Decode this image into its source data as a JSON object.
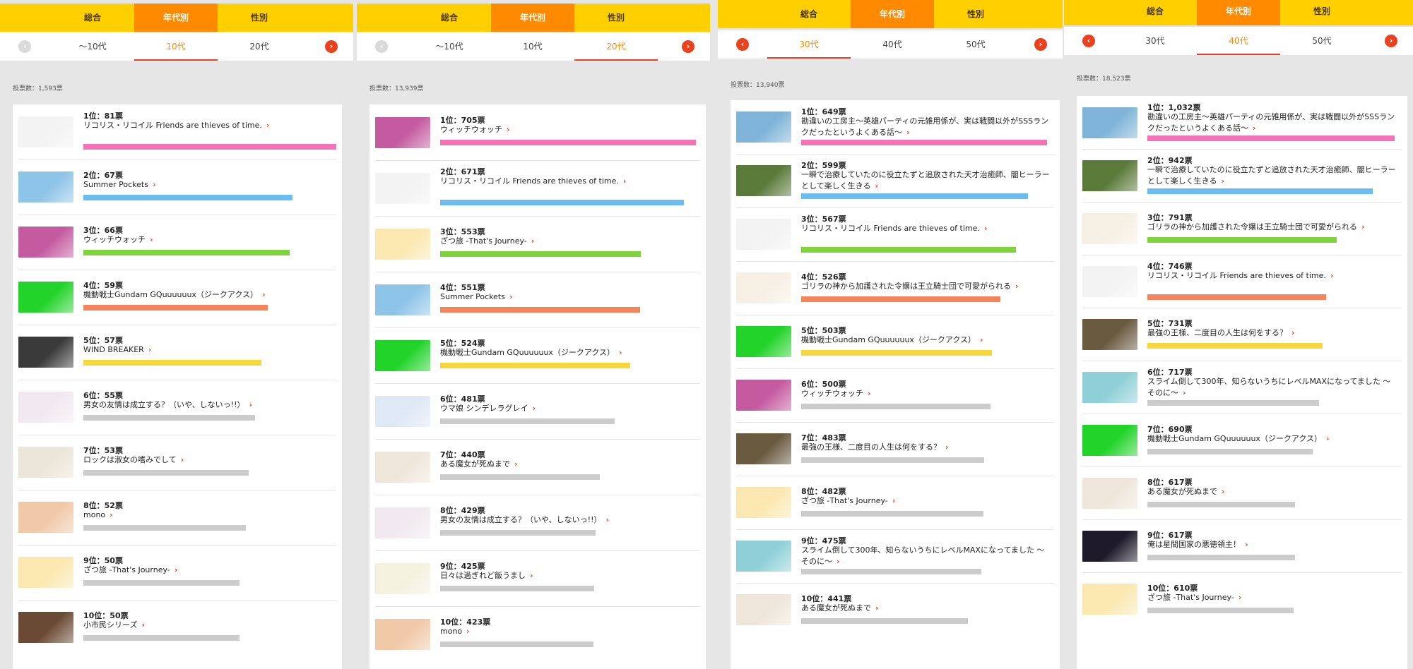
{
  "tabs": [
    "総合",
    "年代別",
    "性別"
  ],
  "arrows": {
    "prev": "‹",
    "next": "›"
  },
  "colors": {
    "yellow": "#ffcf00",
    "orange": "#ff8a00",
    "red": "#e8431e",
    "bar_pink": "#f472b6",
    "bar_blue": "#6bbcf0",
    "bar_green": "#7ed43a",
    "bar_orange": "#f5845a",
    "bar_yellow": "#f7d73a",
    "bar_gray": "#cccccc"
  },
  "panels": [
    {
      "subtabs": [
        "〜10代",
        "10代",
        "20代"
      ],
      "active_subtab": 1,
      "votes_label": "投票数：1,593票",
      "items": [
        {
          "rank": "1位：81票",
          "title": "リコリス・リコイル Friends are thieves of time.",
          "value": 81,
          "thumb": "#f3f3f3"
        },
        {
          "rank": "2位：67票",
          "title": "Summer Pockets",
          "value": 67,
          "thumb": "#8ec4e8"
        },
        {
          "rank": "3位：66票",
          "title": "ウィッチウォッチ",
          "value": 66,
          "thumb": "#c45aa0"
        },
        {
          "rank": "4位：59票",
          "title": "機動戦士Gundam GQuuuuuux（ジークアクス）",
          "value": 59,
          "thumb": "#22d32a"
        },
        {
          "rank": "5位：57票",
          "title": "WIND BREAKER",
          "value": 57,
          "thumb": "#3a3a3a"
        },
        {
          "rank": "6位：55票",
          "title": "男女の友情は成立する？（いや、しないっ!!）",
          "value": 55,
          "thumb": "#f1e9ef"
        },
        {
          "rank": "7位：53票",
          "title": "ロックは淑女の嗜みでして",
          "value": 53,
          "thumb": "#ece5d9"
        },
        {
          "rank": "8位：52票",
          "title": "mono",
          "value": 52,
          "thumb": "#f0c9a8"
        },
        {
          "rank": "9位：50票",
          "title": "ざつ旅 -That's Journey-",
          "value": 50,
          "thumb": "#fbe8b0"
        },
        {
          "rank": "10位：50票",
          "title": "小市民シリーズ",
          "value": 50,
          "thumb": "#6b4a35"
        }
      ]
    },
    {
      "subtabs": [
        "〜10代",
        "10代",
        "20代"
      ],
      "active_subtab": 2,
      "votes_label": "投票数：13,939票",
      "items": [
        {
          "rank": "1位：705票",
          "title": "ウィッチウォッチ",
          "value": 705,
          "thumb": "#c45aa0"
        },
        {
          "rank": "2位：671票",
          "title": "リコリス・リコイル Friends are thieves of time.",
          "value": 671,
          "thumb": "#f3f3f3"
        },
        {
          "rank": "3位：553票",
          "title": "ざつ旅 -That's Journey-",
          "value": 553,
          "thumb": "#fbe8b0"
        },
        {
          "rank": "4位：551票",
          "title": "Summer Pockets",
          "value": 551,
          "thumb": "#8ec4e8"
        },
        {
          "rank": "5位：524票",
          "title": "機動戦士Gundam GQuuuuuux（ジークアクス）",
          "value": 524,
          "thumb": "#22d32a"
        },
        {
          "rank": "6位：481票",
          "title": "ウマ娘 シンデレラグレイ",
          "value": 481,
          "thumb": "#dfe8f5"
        },
        {
          "rank": "7位：440票",
          "title": "ある魔女が死ぬまで",
          "value": 440,
          "thumb": "#efe6da"
        },
        {
          "rank": "8位：429票",
          "title": "男女の友情は成立する？（いや、しないっ!!）",
          "value": 429,
          "thumb": "#f1e9ef"
        },
        {
          "rank": "9位：425票",
          "title": "日々は過ぎれど飯うまし",
          "value": 425,
          "thumb": "#f4f1df"
        },
        {
          "rank": "10位：423票",
          "title": "mono",
          "value": 423,
          "thumb": "#f0c9a8"
        }
      ]
    },
    {
      "subtabs": [
        "30代",
        "40代",
        "50代"
      ],
      "active_subtab": 0,
      "votes_label": "投票数：13,940票",
      "items": [
        {
          "rank": "1位：649票",
          "title": "勘違いの工房主〜英雄パーティの元雑用係が、実は戦闘以外がSSSランクだったというよくある話〜",
          "value": 649,
          "thumb": "#7fb4d8"
        },
        {
          "rank": "2位：599票",
          "title": "一瞬で治療していたのに役立たずと追放された天才治癒師、闇ヒーラーとして楽しく生きる",
          "value": 599,
          "thumb": "#5a7a3a"
        },
        {
          "rank": "3位：567票",
          "title": "リコリス・リコイル Friends are thieves of time.",
          "value": 567,
          "thumb": "#f3f3f3"
        },
        {
          "rank": "4位：526票",
          "title": "ゴリラの神から加護された令嬢は王立騎士団で可愛がられる",
          "value": 526,
          "thumb": "#f6efe4"
        },
        {
          "rank": "5位：503票",
          "title": "機動戦士Gundam GQuuuuuux（ジークアクス）",
          "value": 503,
          "thumb": "#22d32a"
        },
        {
          "rank": "6位：500票",
          "title": "ウィッチウォッチ",
          "value": 500,
          "thumb": "#c45aa0"
        },
        {
          "rank": "7位：483票",
          "title": "最強の王様、二度目の人生は何をする？",
          "value": 483,
          "thumb": "#6a5a40"
        },
        {
          "rank": "8位：482票",
          "title": "ざつ旅 -That's Journey-",
          "value": 482,
          "thumb": "#fbe8b0"
        },
        {
          "rank": "9位：475票",
          "title": "スライム倒して300年、知らないうちにレベルMAXになってました 〜そのに〜",
          "value": 475,
          "thumb": "#8fd0d8"
        },
        {
          "rank": "10位：441票",
          "title": "ある魔女が死ぬまで",
          "value": 441,
          "thumb": "#efe6da"
        }
      ]
    },
    {
      "subtabs": [
        "30代",
        "40代",
        "50代"
      ],
      "active_subtab": 1,
      "votes_label": "投票数：18,523票",
      "items": [
        {
          "rank": "1位：1,032票",
          "title": "勘違いの工房主〜英雄パーティの元雑用係が、実は戦闘以外がSSSランクだったというよくある話〜",
          "value": 1032,
          "thumb": "#7fb4d8"
        },
        {
          "rank": "2位：942票",
          "title": "一瞬で治療していたのに役立たずと追放された天才治癒師、闇ヒーラーとして楽しく生きる",
          "value": 942,
          "thumb": "#5a7a3a"
        },
        {
          "rank": "3位：791票",
          "title": "ゴリラの神から加護された令嬢は王立騎士団で可愛がられる",
          "value": 791,
          "thumb": "#f6efe4"
        },
        {
          "rank": "4位：746票",
          "title": "リコリス・リコイル Friends are thieves of time.",
          "value": 746,
          "thumb": "#f3f3f3"
        },
        {
          "rank": "5位：731票",
          "title": "最強の王様、二度目の人生は何をする？",
          "value": 731,
          "thumb": "#6a5a40"
        },
        {
          "rank": "6位：717票",
          "title": "スライム倒して300年、知らないうちにレベルMAXになってました 〜そのに〜",
          "value": 717,
          "thumb": "#8fd0d8"
        },
        {
          "rank": "7位：690票",
          "title": "機動戦士Gundam GQuuuuuux（ジークアクス）",
          "value": 690,
          "thumb": "#22d32a"
        },
        {
          "rank": "8位：617票",
          "title": "ある魔女が死ぬまで",
          "value": 617,
          "thumb": "#efe6da"
        },
        {
          "rank": "9位：617票",
          "title": "俺は星間国家の悪徳領主！",
          "value": 617,
          "thumb": "#1e1a2a"
        },
        {
          "rank": "10位：610票",
          "title": "ざつ旅 -That's Journey-",
          "value": 610,
          "thumb": "#fbe8b0"
        }
      ]
    }
  ]
}
